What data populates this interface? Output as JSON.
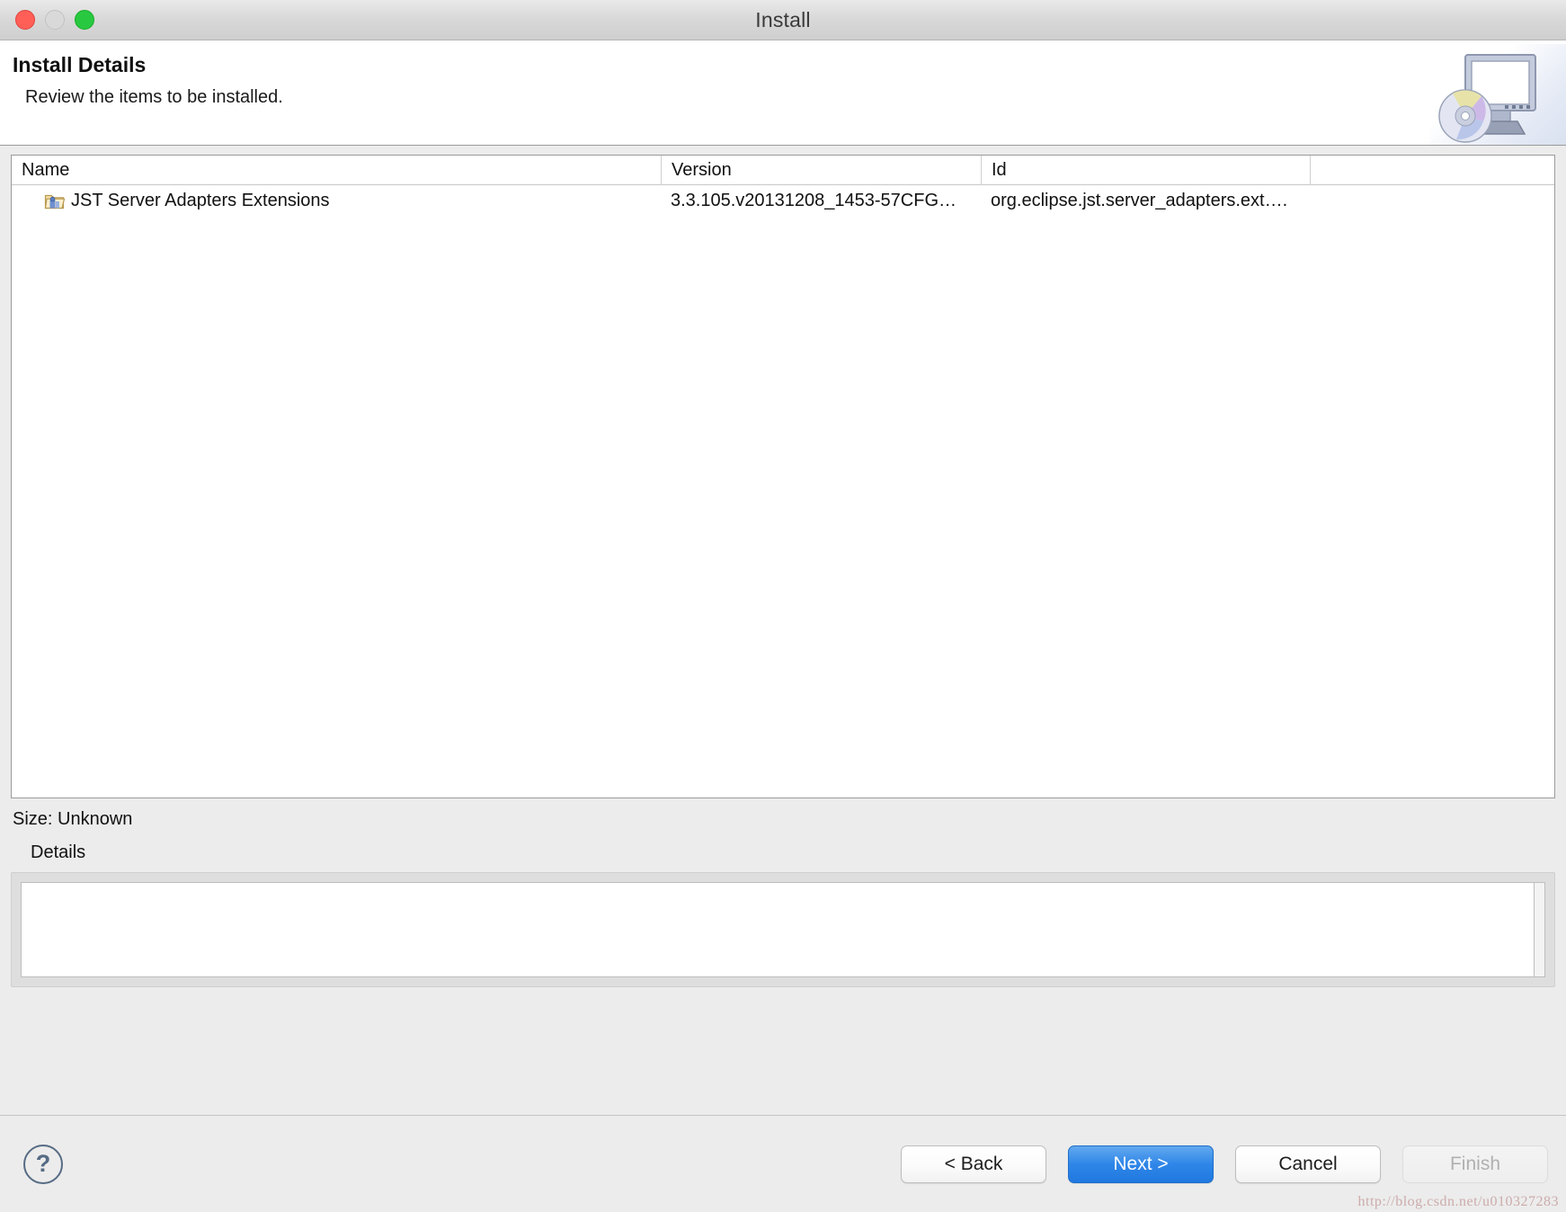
{
  "window": {
    "title": "Install",
    "controls": {
      "close": "close-button",
      "minimize": "minimize-button",
      "zoom": "zoom-button"
    }
  },
  "banner": {
    "title": "Install Details",
    "subtitle": "Review the items to be installed.",
    "art": "install-monitor-cd-icon"
  },
  "table": {
    "columns": [
      "Name",
      "Version",
      "Id"
    ],
    "rows": [
      {
        "icon": "feature-folder-icon",
        "name": "JST Server Adapters Extensions",
        "version": "3.3.105.v20131208_1453-57CFG…",
        "id": "org.eclipse.jst.server_adapters.ext…."
      }
    ]
  },
  "size": {
    "label": "Size: Unknown"
  },
  "details": {
    "label": "Details",
    "content": ""
  },
  "footer": {
    "help_glyph": "?",
    "buttons": [
      {
        "label": "< Back",
        "style": "normal",
        "name": "back-button"
      },
      {
        "label": "Next >",
        "style": "primary",
        "name": "next-button"
      },
      {
        "label": "Cancel",
        "style": "normal",
        "name": "cancel-button"
      },
      {
        "label": "Finish",
        "style": "disabled",
        "name": "finish-button"
      }
    ]
  },
  "watermark": "http://blog.csdn.net/u010327283",
  "colors": {
    "accent": "#2f86e8",
    "titlebar": "#d8d8d8",
    "dialog_bg": "#ececec",
    "close_dot": "#ff5f57",
    "min_dot": "#d9d9d9",
    "zoom_dot": "#28c940"
  }
}
